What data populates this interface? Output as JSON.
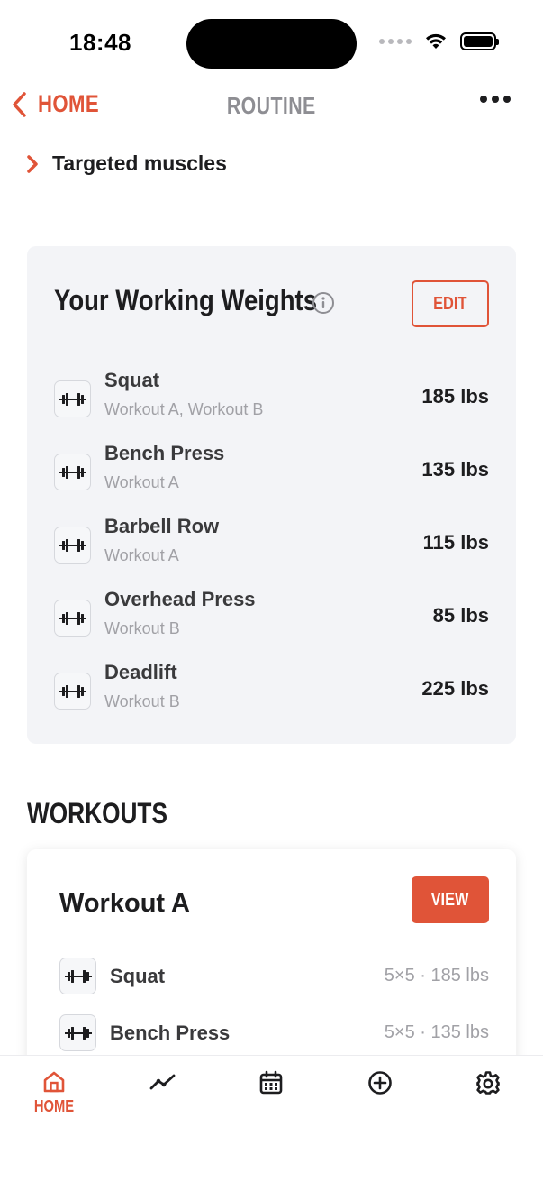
{
  "status_bar": {
    "time": "18:48"
  },
  "nav": {
    "back_label": "HOME",
    "title": "ROUTINE"
  },
  "targeted_muscles": {
    "label": "Targeted muscles"
  },
  "working_weights": {
    "title": "Your Working Weights",
    "edit_label": "EDIT",
    "lifts": [
      {
        "name": "Squat",
        "workouts": "Workout A, Workout B",
        "weight": "185 lbs"
      },
      {
        "name": "Bench Press",
        "workouts": "Workout A",
        "weight": "135 lbs"
      },
      {
        "name": "Barbell Row",
        "workouts": "Workout A",
        "weight": "115 lbs"
      },
      {
        "name": "Overhead Press",
        "workouts": "Workout B",
        "weight": "85 lbs"
      },
      {
        "name": "Deadlift",
        "workouts": "Workout B",
        "weight": "225 lbs"
      }
    ]
  },
  "workouts": {
    "heading": "WORKOUTS",
    "cards": [
      {
        "title": "Workout A",
        "view_label": "VIEW",
        "exercises": [
          {
            "name": "Squat",
            "detail": "5×5 · 185 lbs"
          },
          {
            "name": "Bench Press",
            "detail": "5×5 · 135 lbs"
          }
        ]
      }
    ]
  },
  "tab_bar": {
    "active_tab": "home",
    "tabs": [
      {
        "id": "home",
        "label": "HOME",
        "icon": "home-icon"
      },
      {
        "id": "progress",
        "icon": "trend-line-icon"
      },
      {
        "id": "calendar",
        "icon": "calendar-icon"
      },
      {
        "id": "add",
        "icon": "plus-circle-icon"
      },
      {
        "id": "settings",
        "icon": "gear-icon"
      }
    ]
  },
  "colors": {
    "accent": "#e05438",
    "card_bg": "#f3f4f7",
    "muted_text": "#a1a1a6"
  }
}
